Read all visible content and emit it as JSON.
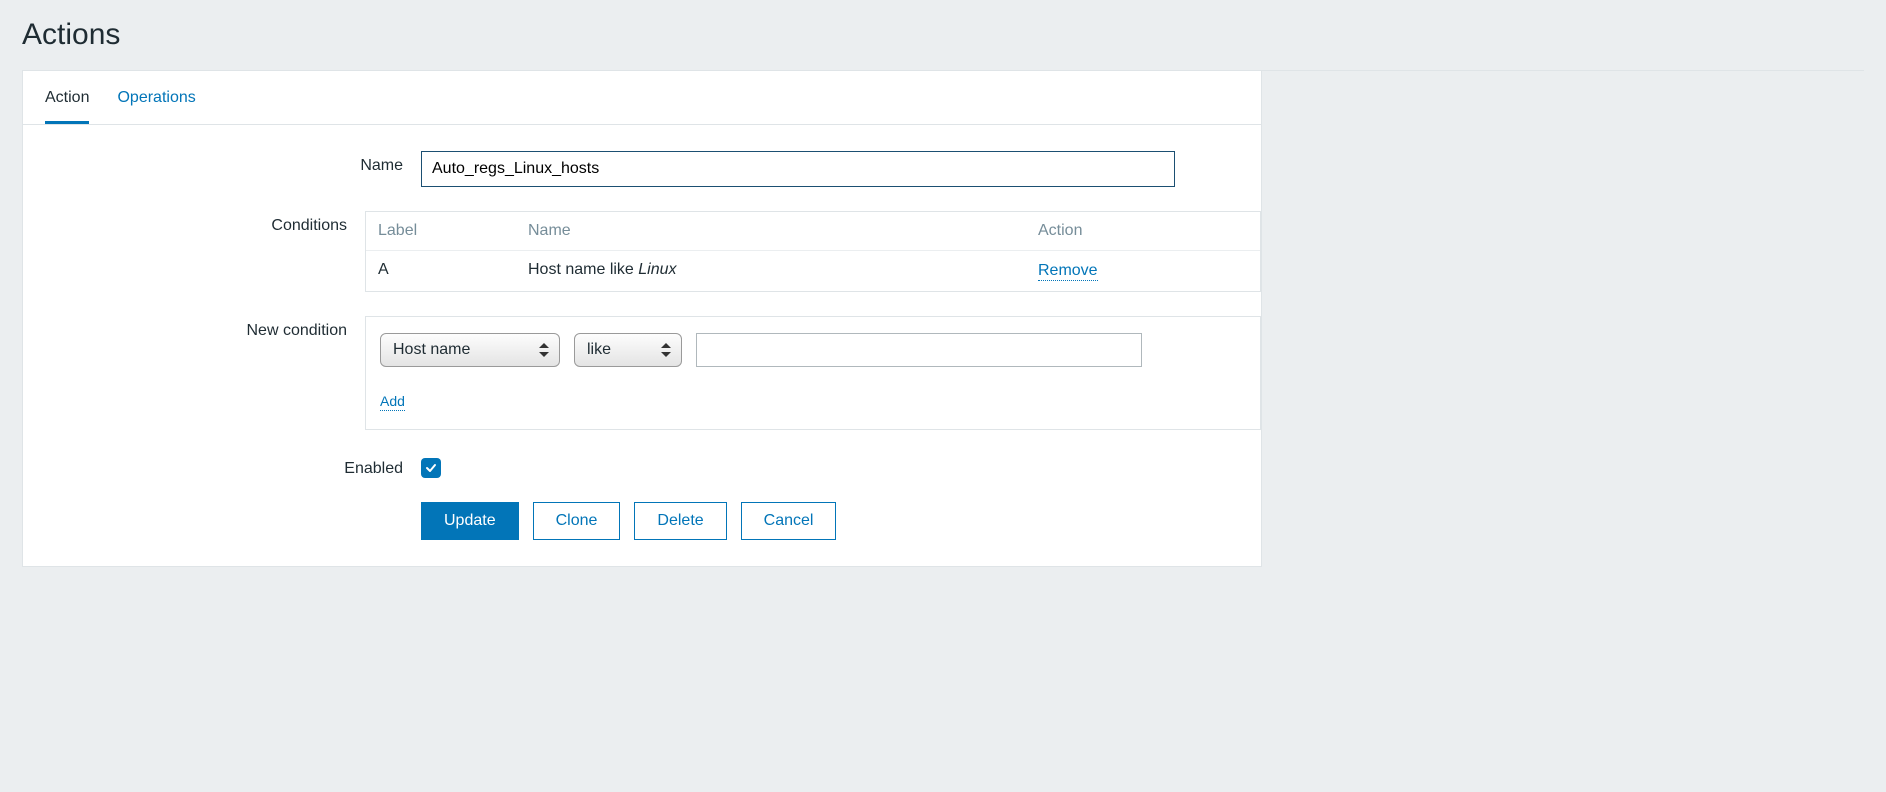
{
  "page_title": "Actions",
  "tabs": {
    "action": "Action",
    "operations": "Operations"
  },
  "labels": {
    "name": "Name",
    "conditions": "Conditions",
    "new_condition": "New condition",
    "enabled": "Enabled"
  },
  "name_value": "Auto_regs_Linux_hosts",
  "conditions_table": {
    "headers": {
      "label": "Label",
      "name": "Name",
      "action": "Action"
    },
    "rows": [
      {
        "label": "A",
        "name_prefix": "Host name like ",
        "name_em": "Linux",
        "action": "Remove"
      }
    ]
  },
  "new_condition": {
    "type": "Host name",
    "operator": "like",
    "value": "",
    "add": "Add"
  },
  "enabled": true,
  "buttons": {
    "update": "Update",
    "clone": "Clone",
    "delete": "Delete",
    "cancel": "Cancel"
  }
}
